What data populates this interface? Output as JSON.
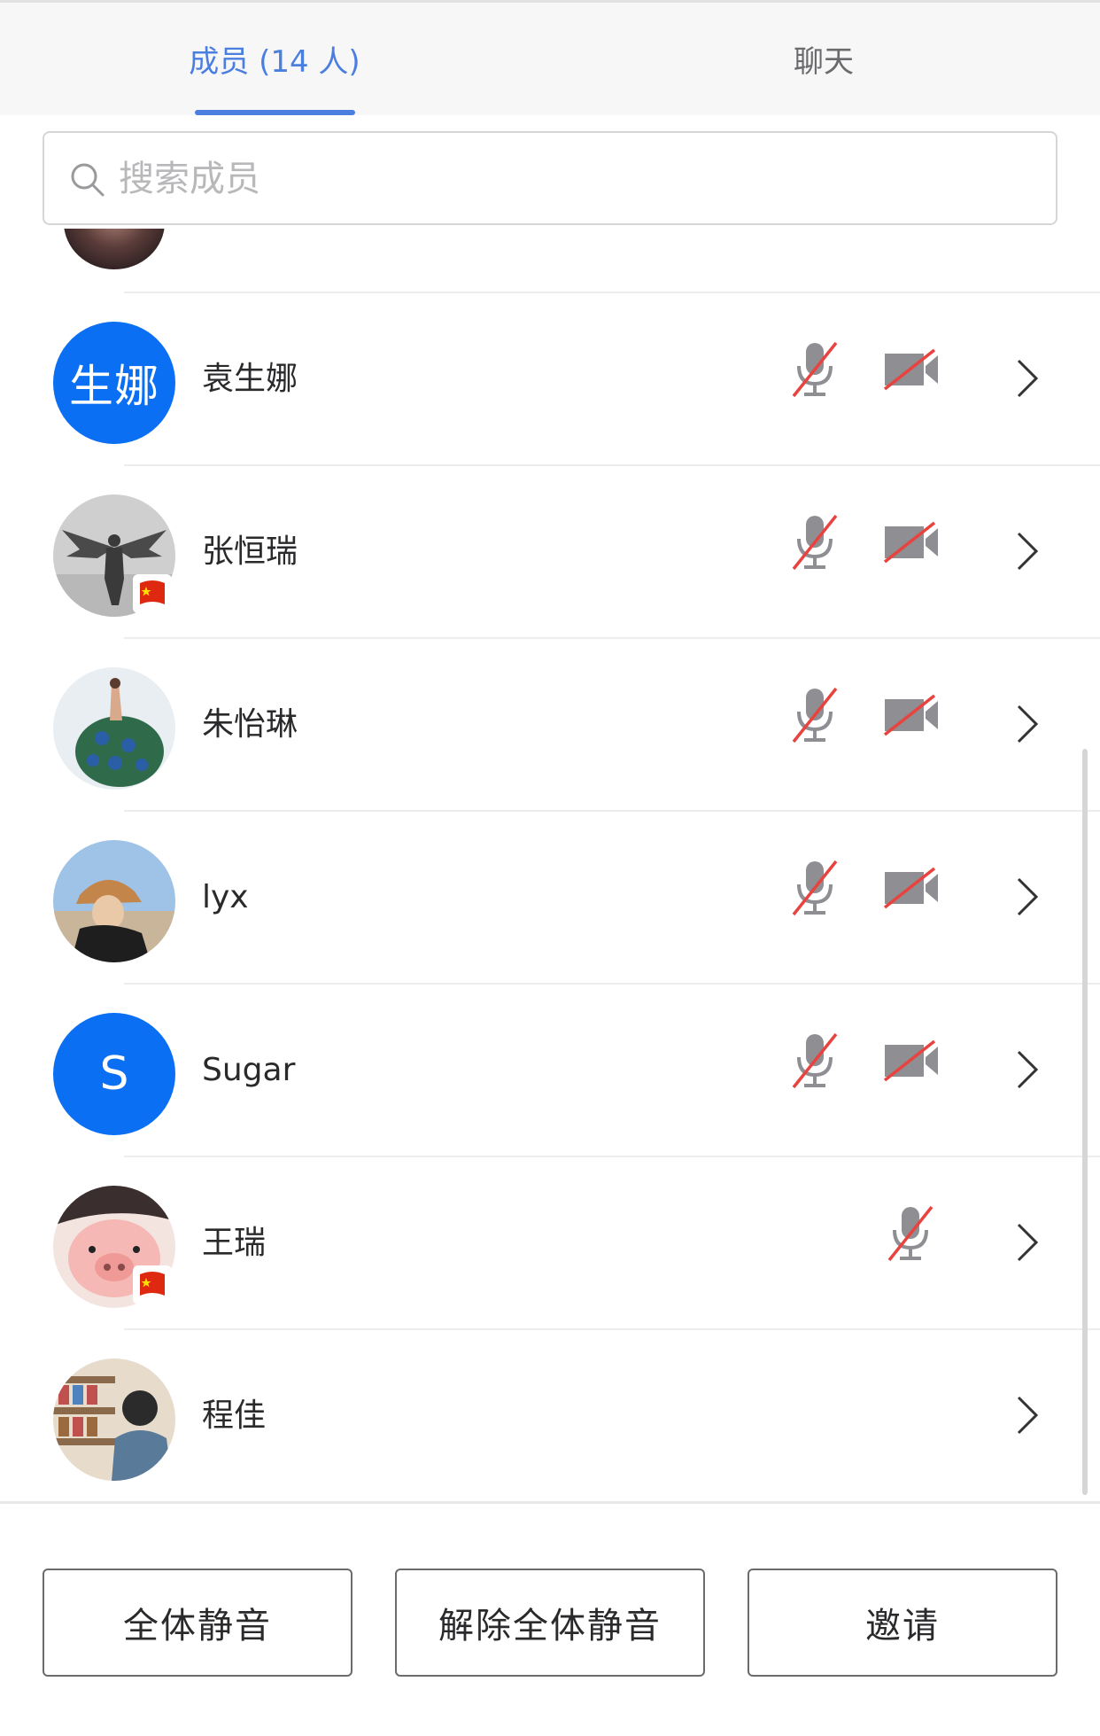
{
  "tabs": [
    {
      "label": "成员 (14 人)",
      "active": true
    },
    {
      "label": "聊天",
      "active": false
    }
  ],
  "search": {
    "placeholder": "搜索成员",
    "value": ""
  },
  "members": [
    {
      "name": "袁生娜",
      "avatar_type": "text",
      "avatar_text": "生娜",
      "mic": "muted",
      "camera": "off",
      "badge": false
    },
    {
      "name": "张恒瑞",
      "avatar_type": "image",
      "avatar_desc": "winged-figure",
      "mic": "muted",
      "camera": "off",
      "badge": true
    },
    {
      "name": "朱怡琳",
      "avatar_type": "image",
      "avatar_desc": "peacock",
      "mic": "muted",
      "camera": "off",
      "badge": false
    },
    {
      "name": "lyx",
      "avatar_type": "image",
      "avatar_desc": "girl-hat",
      "mic": "muted",
      "camera": "off",
      "badge": false
    },
    {
      "name": "Sugar",
      "avatar_type": "letter",
      "avatar_text": "S",
      "mic": "muted",
      "camera": "off",
      "badge": false
    },
    {
      "name": "王瑞",
      "avatar_type": "image",
      "avatar_desc": "pig",
      "mic": "muted",
      "camera": "none",
      "badge": true
    },
    {
      "name": "程佳",
      "avatar_type": "image",
      "avatar_desc": "shop-girl",
      "mic": "none",
      "camera": "none",
      "badge": false
    }
  ],
  "actions": {
    "mute_all": "全体静音",
    "unmute_all": "解除全体静音",
    "invite": "邀请"
  },
  "colors": {
    "accent": "#4a7fe0",
    "avatar_blue": "#0b6ff4",
    "muted_red": "#e8433f",
    "icon_gray": "#8e8e93"
  }
}
